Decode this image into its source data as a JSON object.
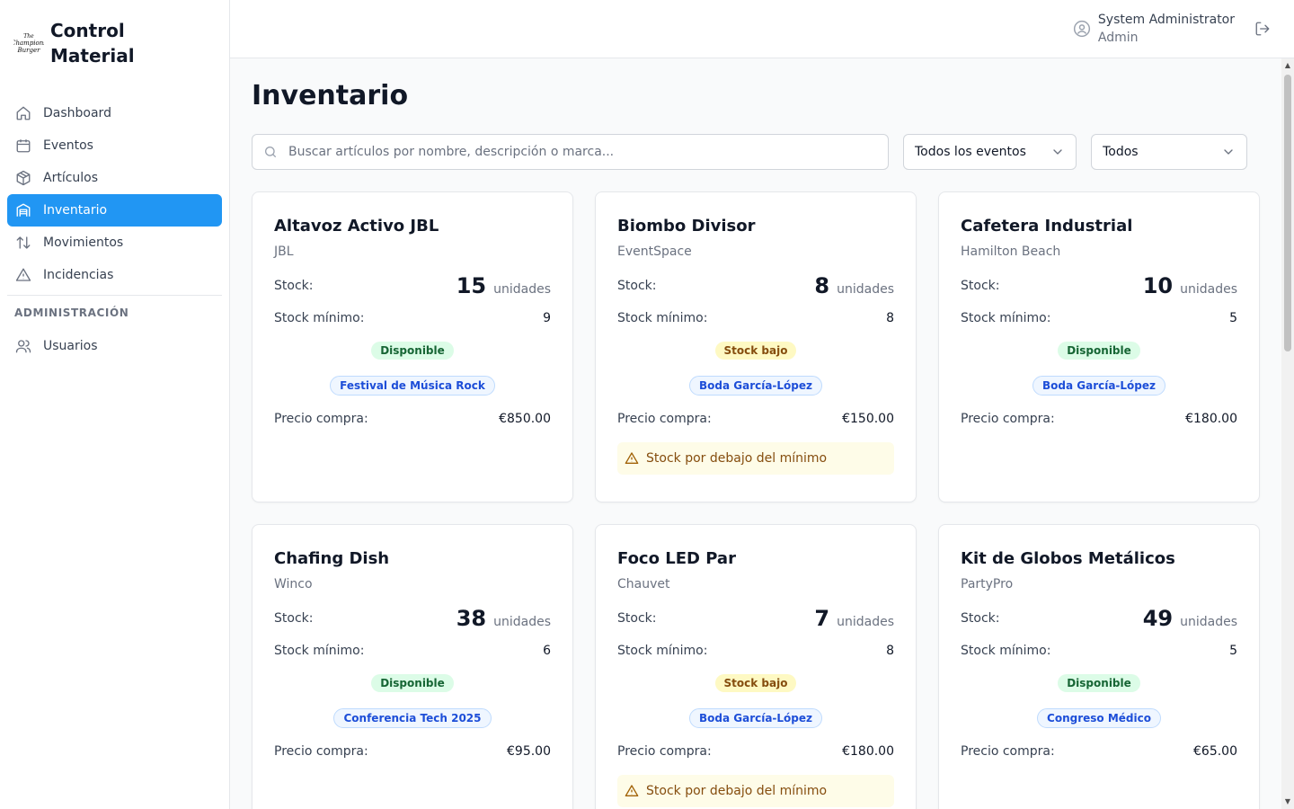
{
  "brand": {
    "title_line1": "Control",
    "title_line2": "Material",
    "logo_text": "The Champions Burger"
  },
  "nav": {
    "items": [
      {
        "label": "Dashboard",
        "icon": "home-icon",
        "active": false
      },
      {
        "label": "Eventos",
        "icon": "calendar-icon",
        "active": false
      },
      {
        "label": "Artículos",
        "icon": "package-icon",
        "active": false
      },
      {
        "label": "Inventario",
        "icon": "warehouse-icon",
        "active": true
      },
      {
        "label": "Movimientos",
        "icon": "arrows-up-down-icon",
        "active": false
      },
      {
        "label": "Incidencias",
        "icon": "alert-triangle-icon",
        "active": false
      }
    ],
    "admin_section": "ADMINISTRACIÓN",
    "admin_items": [
      {
        "label": "Usuarios",
        "icon": "users-icon",
        "active": false
      }
    ]
  },
  "header": {
    "user_name": "System Administrator",
    "user_role": "Admin"
  },
  "main": {
    "title": "Inventario",
    "search_placeholder": "Buscar artículos por nombre, descripción o marca...",
    "event_filter": "Todos los eventos",
    "status_filter": "Todos"
  },
  "labels": {
    "stock": "Stock:",
    "units": "unidades",
    "min_stock": "Stock mínimo:",
    "price": "Precio compra:",
    "warning": "Stock por debajo del mínimo"
  },
  "items": [
    {
      "name": "Altavoz Activo JBL",
      "brand": "JBL",
      "stock": "15",
      "min": "9",
      "status": "Disponible",
      "status_type": "ok",
      "event": "Festival de Música Rock",
      "price": "€850.00",
      "warning": false
    },
    {
      "name": "Biombo Divisor",
      "brand": "EventSpace",
      "stock": "8",
      "min": "8",
      "status": "Stock bajo",
      "status_type": "low",
      "event": "Boda García-López",
      "price": "€150.00",
      "warning": true
    },
    {
      "name": "Cafetera Industrial",
      "brand": "Hamilton Beach",
      "stock": "10",
      "min": "5",
      "status": "Disponible",
      "status_type": "ok",
      "event": "Boda García-López",
      "price": "€180.00",
      "warning": false
    },
    {
      "name": "Chafing Dish",
      "brand": "Winco",
      "stock": "38",
      "min": "6",
      "status": "Disponible",
      "status_type": "ok",
      "event": "Conferencia Tech 2025",
      "price": "€95.00",
      "warning": false
    },
    {
      "name": "Foco LED Par",
      "brand": "Chauvet",
      "stock": "7",
      "min": "8",
      "status": "Stock bajo",
      "status_type": "low",
      "event": "Boda García-López",
      "price": "€180.00",
      "warning": true
    },
    {
      "name": "Kit de Globos Metálicos",
      "brand": "PartyPro",
      "stock": "49",
      "min": "5",
      "status": "Disponible",
      "status_type": "ok",
      "event": "Congreso Médico",
      "price": "€65.00",
      "warning": false
    }
  ]
}
